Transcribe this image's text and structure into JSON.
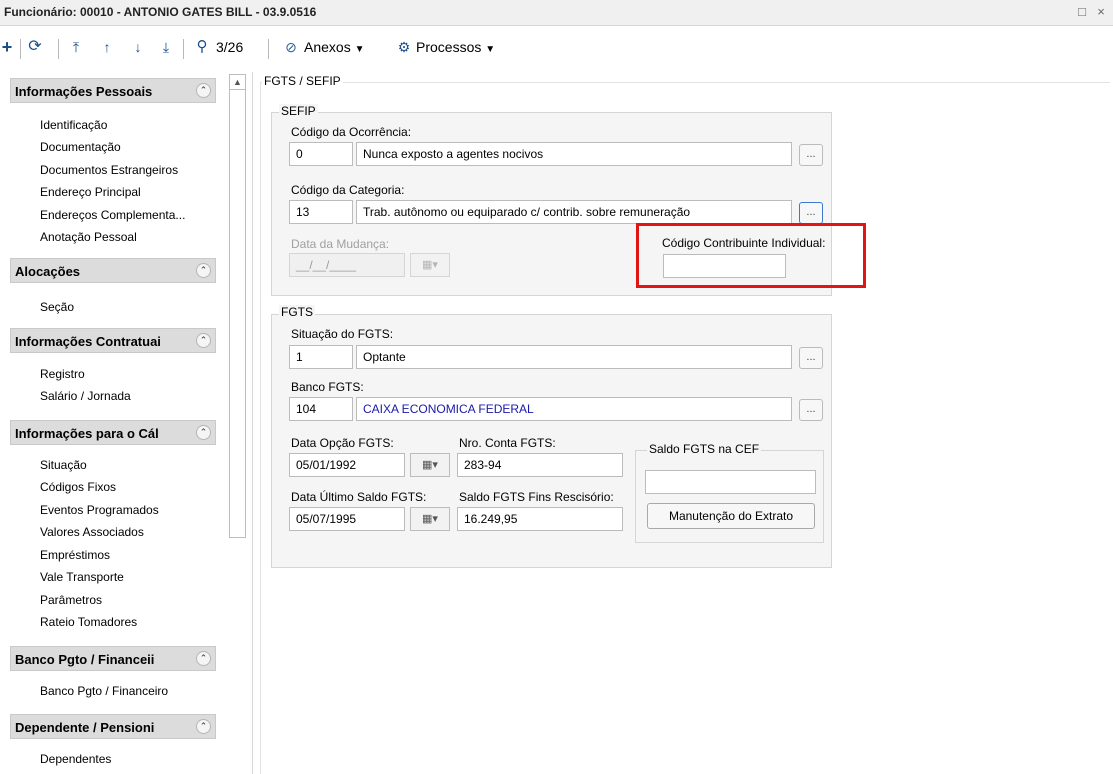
{
  "window": {
    "title": "Funcionário: 00010 - ANTONIO GATES BILL - 03.9.0516",
    "maximize_glyph": "□",
    "close_glyph": "×"
  },
  "toolbar": {
    "record_counter": "3/26",
    "anexos_label": "Anexos",
    "processos_label": "Processos",
    "icons": [
      "plus-icon",
      "refresh-icon",
      "first-record-icon",
      "previous-record-icon",
      "next-record-icon",
      "last-record-icon",
      "search-icon",
      "paperclip-icon",
      "gear-icon"
    ]
  },
  "sidebar": {
    "sections": [
      {
        "title": "Informações Pessoais",
        "items": [
          "Identificação",
          "Documentação",
          "Documentos Estrangeiros",
          "Endereço Principal",
          "Endereços Complementa...",
          "Anotação Pessoal"
        ]
      },
      {
        "title": "Alocações",
        "items": [
          "Seção"
        ]
      },
      {
        "title": "Informações Contratuai",
        "items": [
          "Registro",
          "Salário / Jornada"
        ]
      },
      {
        "title": "Informações para o Cál",
        "items": [
          "Situação",
          "Códigos Fixos",
          "Eventos Programados",
          "Valores Associados",
          "Empréstimos",
          "Vale Transporte",
          "Parâmetros",
          "Rateio Tomadores"
        ]
      },
      {
        "title": "Banco Pgto / Financeii",
        "items": [
          "Banco Pgto / Financeiro"
        ]
      },
      {
        "title": "Dependente / Pensioni",
        "items": [
          "Dependentes"
        ]
      }
    ]
  },
  "form": {
    "section_title": "FGTS / SEFIP",
    "sefip": {
      "legend": "SEFIP",
      "ocorrencia_label": "Código da Ocorrência:",
      "ocorrencia_code": "0",
      "ocorrencia_desc": "Nunca exposto a agentes nocivos",
      "categoria_label": "Código da Categoria:",
      "categoria_code": "13",
      "categoria_desc": "Trab. autônomo ou equiparado c/ contrib. sobre remuneração",
      "data_mudanca_label": "Data da Mudança:",
      "data_mudanca_value": "__/__/____",
      "contribuinte_label": "Código Contribuinte Individual:",
      "contribuinte_value": ""
    },
    "fgts": {
      "legend": "FGTS",
      "situacao_label": "Situação do FGTS:",
      "situacao_code": "1",
      "situacao_desc": "Optante",
      "banco_label": "Banco FGTS:",
      "banco_code": "104",
      "banco_desc": "CAIXA ECONOMICA FEDERAL",
      "data_opcao_label": "Data Opção FGTS:",
      "data_opcao_value": "05/01/1992",
      "nro_conta_label": "Nro. Conta FGTS:",
      "nro_conta_value": "283-94",
      "data_ultimo_label": "Data Último Saldo FGTS:",
      "data_ultimo_value": "05/07/1995",
      "saldo_rescisorio_label": "Saldo FGTS Fins Rescisório:",
      "saldo_rescisorio_value": "16.249,95",
      "saldo_cef_legend": "Saldo FGTS na CEF",
      "saldo_cef_value": "",
      "manutencao_button": "Manutenção do Extrato"
    },
    "ellipsis": "...",
    "calendar_glyph": "▦▾"
  },
  "colors": {
    "highlight": "#e01515",
    "link_blue": "#1a1aa8",
    "toolbar_icon": "#1a4f8b"
  }
}
